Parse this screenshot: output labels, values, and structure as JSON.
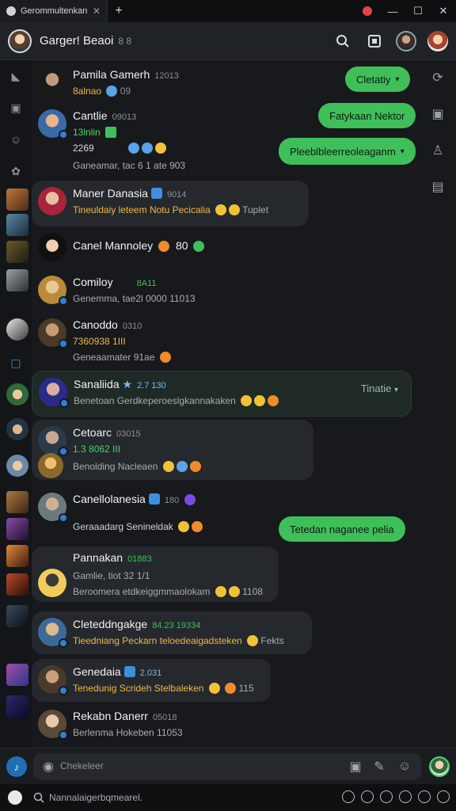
{
  "titlebar": {
    "tab_title": "Gerommultenkan",
    "new_tab": "+",
    "close": "✕",
    "minimize": "—",
    "maximize": "☐",
    "window_close": "✕"
  },
  "header": {
    "name": "Garger! Beaoi",
    "sub": "8 8"
  },
  "bubbles": [
    {
      "text": "Cletatiy"
    },
    {
      "text": "Fatykaan Nektor"
    },
    {
      "text": "Pleeblbleerreoleaganm"
    },
    {
      "text": "Tetedan naganee pelia"
    }
  ],
  "chats": [
    {
      "name": "Pamila",
      "extra": "Gamerh",
      "time": "12013",
      "preview": "8alnao",
      "tail": "09"
    },
    {
      "name": "Cantlie",
      "time": "09013",
      "preview": "13lnlin",
      "line2": "2269",
      "line3": "Ganeamar, tac 6 1 ate 903"
    },
    {
      "name": "Maner Danasia",
      "time": "9014",
      "preview": "Tineuldaiy leteem Notu Pecicalia",
      "tail": "Tuplet"
    },
    {
      "name": "Canel Mannoley",
      "time": "80",
      "preview": ""
    },
    {
      "name": "Comiloy",
      "time": "8A11",
      "preview": "Genemma, tae2l 0000 11013"
    },
    {
      "name": "Canoddo",
      "time": "0310",
      "preview": "7360938 1III",
      "line2": "Geneaamater 91ae"
    },
    {
      "name": "Sanaliida",
      "time": "2.7 130",
      "preview": "Benetoan Gerdkeperoeslgkannakaken",
      "tag": "Tinatie"
    },
    {
      "name": "Cetoarc",
      "time": "03015",
      "preview": "1.3 8062 III",
      "line2": "Benolding Nacleaen"
    },
    {
      "name": "Canellolanesia",
      "time": "180",
      "preview": "Geraaadarg Senineldak"
    },
    {
      "name": "Pannakan",
      "time": "01883",
      "preview": "Gamlie, tiot 32 1/1",
      "line2": "Beroomera etdkeiggmmaolokam",
      "tail": "1108"
    },
    {
      "name": "Cleteddngakge",
      "time": "84.23 19334",
      "preview": "Tieedniang Peckarn teloedeaigadsteken",
      "tail": "Fekts"
    },
    {
      "name": "Genedaia",
      "time": "2.031",
      "preview": "Tenedunig Scrideh Stelbaleken",
      "tail": "115"
    },
    {
      "name": "Rekabn Danerr",
      "time": "05018",
      "preview": "Berlenma Hokeben 11053"
    }
  ],
  "composer": {
    "placeholder": "Chekeleer"
  },
  "bottombar": {
    "search_placeholder": "Nannalaigerbqmearel."
  }
}
